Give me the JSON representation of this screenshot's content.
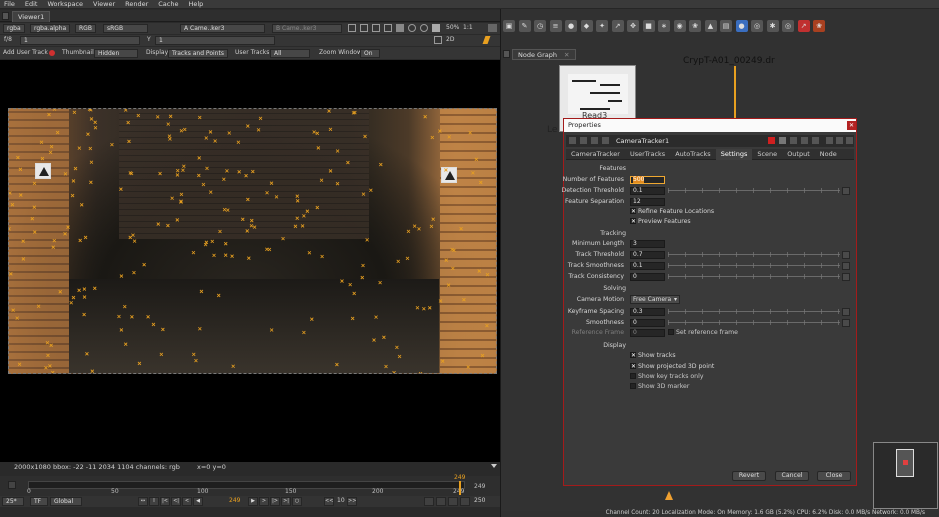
{
  "menu": [
    "File",
    "Edit",
    "Workspace",
    "Viewer",
    "Render",
    "Cache",
    "Help"
  ],
  "viewer": {
    "tab_label": "Viewer1",
    "channels": "rgba",
    "alpha": "rgba.alpha",
    "color": "RGB",
    "lut": "sRGB",
    "input_a": "A  Came..ker3",
    "input_b": "B  Came..ker3",
    "zoom": "50%",
    "ratio": "1:1",
    "view_mode": "2D",
    "fstop_label": "f/8",
    "fstop_value": "1",
    "y_label": "Y",
    "y_value": "1",
    "toolbar2": {
      "add_user_track": "Add User Track",
      "thumbnails_label": "Thumbnails",
      "thumbnails_value": "Hidden",
      "display_label": "Display",
      "display_value": "Tracks and Points",
      "user_tracks_label": "User Tracks",
      "user_tracks_value": "All",
      "zoom_window_label": "Zoom Window",
      "zoom_window_value": "On"
    },
    "info_left": "2000x1080  bbox: -22 -11 2034 1104 channels: rgb",
    "info_right": "x=0 y=0"
  },
  "timeline": {
    "ticks": [
      "0",
      "50",
      "100",
      "150",
      "200",
      "249"
    ],
    "marker": "249",
    "start": "0",
    "end": "249",
    "fps": "25*",
    "tf": "TF",
    "scope": "Global",
    "current_frame": "249",
    "step": "10",
    "end_frame": "250"
  },
  "node_graph": {
    "tab_label": "Node Graph",
    "node_label_top": "CrypT-A01_00249.dr",
    "read_node_label": "Read3",
    "left_label": "Le"
  },
  "properties": {
    "title": "Properties",
    "node_name": "CameraTracker1",
    "tabs": [
      "CameraTracker",
      "UserTracks",
      "AutoTracks",
      "Settings",
      "Scene",
      "Output",
      "Node"
    ],
    "active_tab": "Settings",
    "sections": {
      "features": "Features",
      "tracking": "Tracking",
      "solving": "Solving",
      "display": "Display"
    },
    "fields": {
      "num_features_label": "Number of Features",
      "num_features_value": "500",
      "detection_threshold_label": "Detection Threshold",
      "detection_threshold_value": "0.1",
      "feature_separation_label": "Feature Separation",
      "feature_separation_value": "12",
      "refine_feature_label": "Refine Feature Locations",
      "preview_features_label": "Preview Features",
      "minimum_length_label": "Minimum Length",
      "minimum_length_value": "3",
      "track_threshold_label": "Track Threshold",
      "track_threshold_value": "0.7",
      "track_smoothness_label": "Track Smoothness",
      "track_smoothness_value": "0.1",
      "track_consistency_label": "Track Consistency",
      "track_consistency_value": "0",
      "camera_motion_label": "Camera Motion",
      "camera_motion_value": "Free Camera",
      "keyframe_spacing_label": "Keyframe Spacing",
      "keyframe_spacing_value": "0.3",
      "smoothness_label": "Smoothness",
      "smoothness_value": "0",
      "reference_frame_label": "Reference Frame",
      "reference_frame_value": "0",
      "set_reference_label": "Set reference frame",
      "show_tracks_label": "Show tracks",
      "show_projected_label": "Show projected 3D point",
      "show_key_tracks_label": "Show key tracks only",
      "show_3d_marker_label": "Show 3D marker"
    },
    "checks": {
      "refine_feature": true,
      "preview_features": true,
      "set_reference": false,
      "show_tracks": true,
      "show_projected": true,
      "show_key_tracks": false,
      "show_3d_marker": false
    },
    "buttons": {
      "revert": "Revert",
      "cancel": "Cancel",
      "close": "Close"
    }
  },
  "status_bar": "Channel Count: 20  Localization Mode: On  Memory: 1.6 GB (5.2%)  CPU: 6.2%  Disk: 0.0 MB/s  Network: 0.0 MB/s",
  "colors": {
    "accent_orange": "#e8a020",
    "props_border": "#a31b1b",
    "close_red": "#b32222"
  }
}
